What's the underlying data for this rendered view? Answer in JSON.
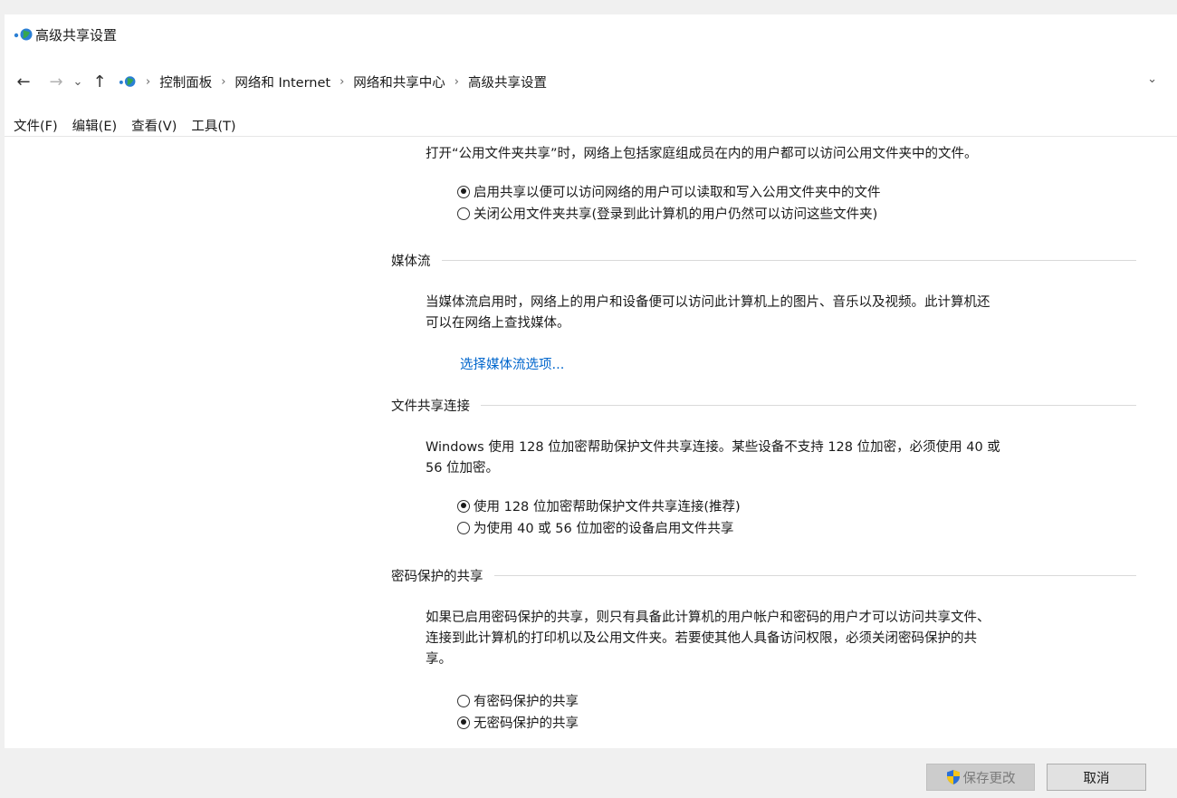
{
  "window": {
    "title": "高级共享设置"
  },
  "address_bar": {
    "back_icon": "←",
    "forward_icon": "→",
    "recent_icon": "⌄",
    "up_icon": "↑",
    "breadcrumbs": [
      "控制面板",
      "网络和 Internet",
      "网络和共享中心",
      "高级共享设置"
    ],
    "separator": "›",
    "dropdown_icon": "⌄"
  },
  "menu": {
    "items": [
      "文件(F)",
      "编辑(E)",
      "查看(V)",
      "工具(T)"
    ]
  },
  "public_folder": {
    "description": "打开“公用文件夹共享”时，网络上包括家庭组成员在内的用户都可以访问公用文件夹中的文件。",
    "options": [
      {
        "label": "启用共享以便可以访问网络的用户可以读取和写入公用文件夹中的文件",
        "selected": true
      },
      {
        "label": "关闭公用文件夹共享(登录到此计算机的用户仍然可以访问这些文件夹)",
        "selected": false
      }
    ]
  },
  "media_streaming": {
    "heading": "媒体流",
    "description_line1": "当媒体流启用时，网络上的用户和设备便可以访问此计算机上的图片、音乐以及视频。此计算机还",
    "description_line2": "可以在网络上查找媒体。",
    "link": "选择媒体流选项..."
  },
  "file_sharing": {
    "heading": "文件共享连接",
    "description_line1": "Windows 使用 128 位加密帮助保护文件共享连接。某些设备不支持 128 位加密，必须使用 40 或",
    "description_line2": "56 位加密。",
    "options": [
      {
        "label": "使用 128 位加密帮助保护文件共享连接(推荐)",
        "selected": true
      },
      {
        "label": "为使用 40 或 56 位加密的设备启用文件共享",
        "selected": false
      }
    ]
  },
  "password_sharing": {
    "heading": "密码保护的共享",
    "description_line1": "如果已启用密码保护的共享，则只有具备此计算机的用户帐户和密码的用户才可以访问共享文件、",
    "description_line2": "连接到此计算机的打印机以及公用文件夹。若要使其他人具备访问权限，必须关闭密码保护的共",
    "description_line3": "享。",
    "options": [
      {
        "label": "有密码保护的共享",
        "selected": false
      },
      {
        "label": "无密码保护的共享",
        "selected": true
      }
    ]
  },
  "footer": {
    "save_label": "保存更改",
    "cancel_label": "取消"
  }
}
